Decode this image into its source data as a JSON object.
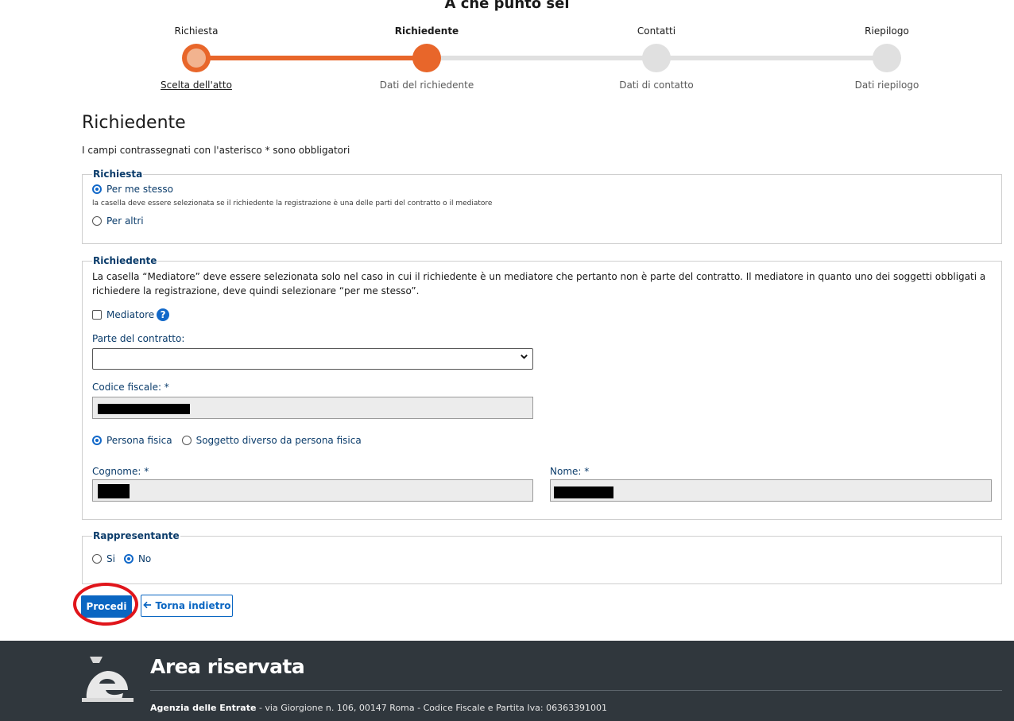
{
  "stepper": {
    "title": "A che punto sei",
    "steps": [
      {
        "label": "Richiesta",
        "sub": "Scelta dell'atto",
        "state": "done"
      },
      {
        "label": "Richiedente",
        "sub": "Dati del richiedente",
        "state": "current"
      },
      {
        "label": "Contatti",
        "sub": "Dati di contatto",
        "state": "todo"
      },
      {
        "label": "Riepilogo",
        "sub": "Dati riepilogo",
        "state": "todo"
      }
    ]
  },
  "page": {
    "title": "Richiedente",
    "required_note": "I campi contrassegnati con l'asterisco * sono obbligatori"
  },
  "richiesta": {
    "legend": "Richiesta",
    "option_self": "Per me stesso",
    "option_self_hint": "la casella deve essere selezionata se il richiedente la registrazione è una delle parti del contratto o il mediatore",
    "option_others": "Per altri",
    "selected": "Per me stesso"
  },
  "richiedente": {
    "legend": "Richiedente",
    "info": "La casella “Mediatore” deve essere selezionata solo nel caso in cui il richiedente è un mediatore che pertanto non è parte del contratto. Il mediatore in quanto uno dei soggetti obbligati a richiedere la registrazione, deve quindi selezionare “per me stesso”.",
    "mediatore_label": "Mediatore",
    "mediatore_checked": false,
    "parte_label": "Parte del contratto:",
    "parte_value": "",
    "codice_label": "Codice fiscale: *",
    "persona_fisica": "Persona fisica",
    "soggetto_diverso": "Soggetto diverso da persona fisica",
    "persona_selected": "Persona fisica",
    "cognome_label": "Cognome: *",
    "nome_label": "Nome: *"
  },
  "rappresentante": {
    "legend": "Rappresentante",
    "option_si": "Si",
    "option_no": "No",
    "selected": "No"
  },
  "actions": {
    "proceed": "Procedi",
    "back": "Torna indietro"
  },
  "footer": {
    "title": "Area riservata",
    "agency": "Agenzia delle Entrate",
    "address": " - via Giorgione n. 106, 00147 Roma - Codice Fiscale e Partita Iva: 06363391001"
  },
  "colors": {
    "accent_orange": "#e8662a",
    "primary_blue": "#0a66c2",
    "footer_bg": "#30373d",
    "highlight_red": "#e0151b"
  }
}
